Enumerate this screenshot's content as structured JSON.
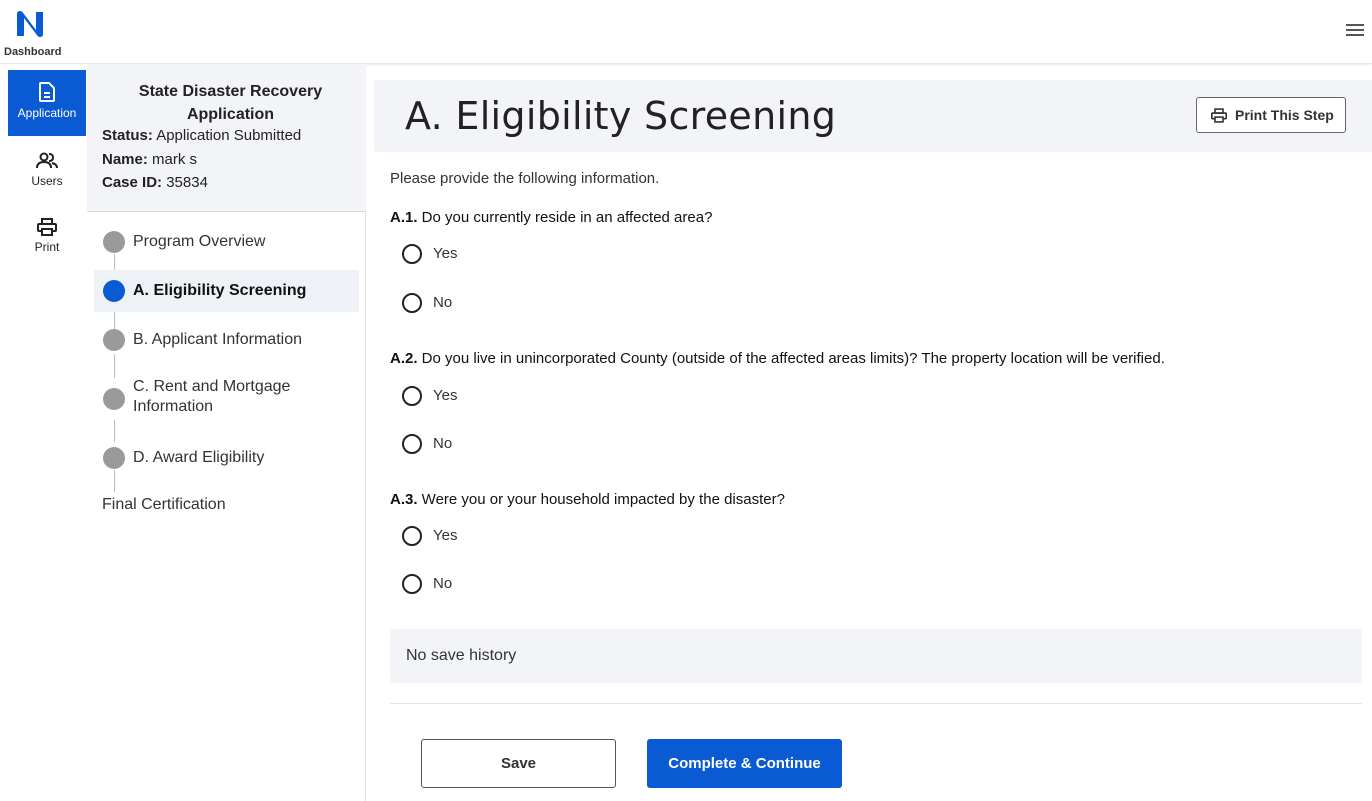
{
  "topbar": {
    "logo_icon": "n-logo-icon",
    "dashboard_label": "Dashboard",
    "menu_icon": "hamburger-menu-icon",
    "brand_color": "#0a5bd3"
  },
  "rail": {
    "items": [
      {
        "label": "Application",
        "icon": "document-icon",
        "active": true
      },
      {
        "label": "Users",
        "icon": "users-icon",
        "active": false
      },
      {
        "label": "Print",
        "icon": "printer-icon",
        "active": false
      }
    ]
  },
  "sidebar": {
    "app_title": "State Disaster Recovery Application",
    "status_label": "Status:",
    "status_value": "Application Submitted",
    "name_label": "Name:",
    "name_value": "mark s",
    "case_label": "Case ID:",
    "case_value": "35834",
    "steps": [
      {
        "label": "Program Overview",
        "active": false
      },
      {
        "label": "A. Eligibility Screening",
        "active": true
      },
      {
        "label": "B. Applicant Information",
        "active": false
      },
      {
        "label": "C. Rent and Mortgage Information",
        "active": false
      },
      {
        "label": "D. Award Eligibility",
        "active": false
      }
    ],
    "final": "Final Certification"
  },
  "main": {
    "title": "A. Eligibility Screening",
    "print_button": "Print This Step",
    "intro": "Please provide the following information.",
    "questions": [
      {
        "number": "A.1.",
        "text": " Do you currently reside in an affected area?",
        "options": [
          "Yes",
          "No"
        ]
      },
      {
        "number": "A.2.",
        "text": " Do you live in unincorporated County (outside of the affected areas limits)? The property location will be verified.",
        "options": [
          "Yes",
          "No"
        ]
      },
      {
        "number": "A.3.",
        "text": " Were you or your household impacted by the disaster?",
        "options": [
          "Yes",
          "No"
        ]
      }
    ],
    "save_history": "No save history",
    "save_button": "Save",
    "continue_button": "Complete & Continue"
  }
}
